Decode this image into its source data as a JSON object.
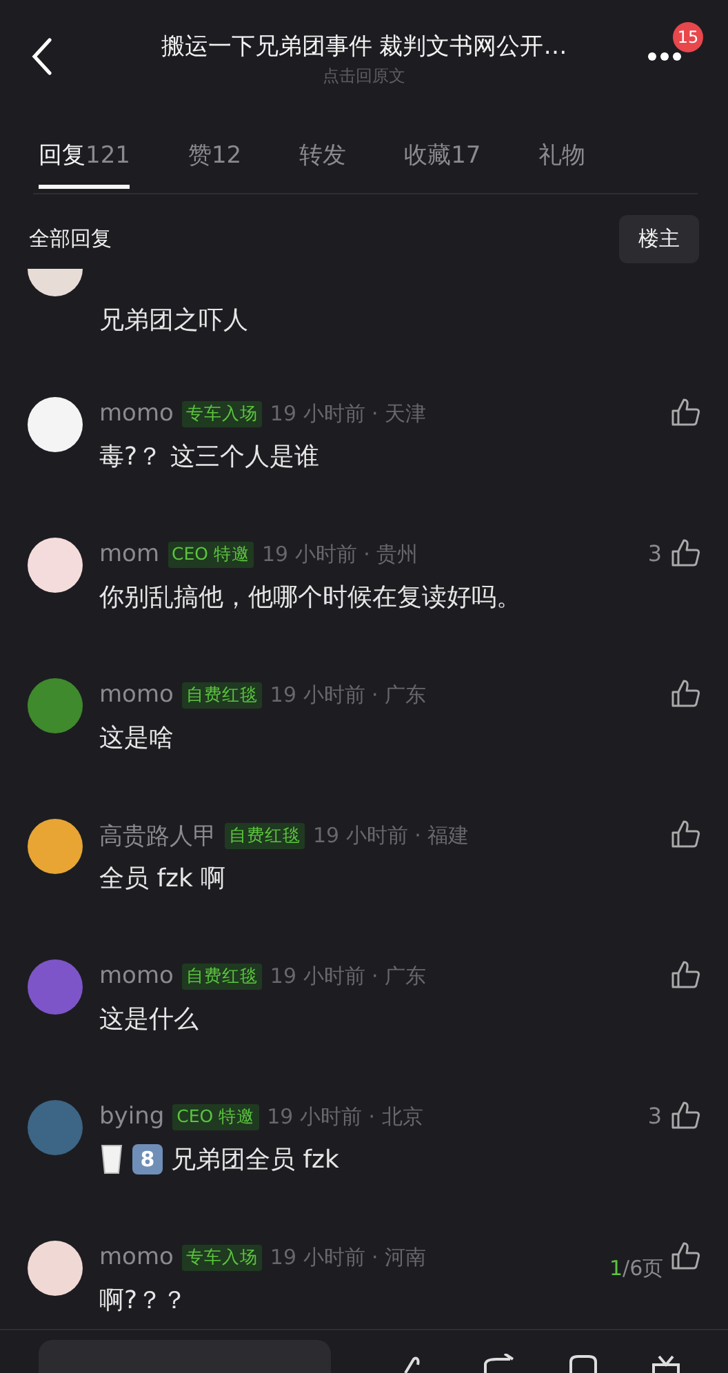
{
  "header": {
    "title": "搬运一下兄弟团事件 裁判文书网公开…",
    "subtitle": "点击回原文",
    "badge": "15"
  },
  "tabs": [
    {
      "label": "回复",
      "count": "121",
      "selected": true
    },
    {
      "label": "赞",
      "count": "12",
      "selected": false
    },
    {
      "label": "转发",
      "selected": false
    },
    {
      "label": "收藏",
      "count": "17",
      "selected": false
    },
    {
      "label": "礼物",
      "selected": false
    }
  ],
  "filter": {
    "label": "全部回复",
    "button": "楼主"
  },
  "comments": [
    {
      "kind": "partial",
      "color": "#e8ddd6",
      "text": "兄弟团之吓人"
    },
    {
      "kind": "full",
      "color": "#f4f4f4",
      "name": "momo",
      "tag": "专车入场",
      "meta": "19 小时前 · 天津",
      "text": "毒?？ 这三个人是谁"
    },
    {
      "kind": "full",
      "color": "#f5dcdc",
      "name": "mom",
      "tag": "CEO 特邀",
      "meta": "19 小时前 · 贵州",
      "text": "你别乱搞他，他哪个时候在复读好吗。",
      "likes": "3"
    },
    {
      "kind": "full",
      "color": "#3f8a2c",
      "name": "momo",
      "tag": "自费红毯",
      "meta": "19 小时前 · 广东",
      "text": "这是啥"
    },
    {
      "kind": "full",
      "color": "#e8a534",
      "name": "高贵路人甲",
      "tag": "自费红毯",
      "meta": "19 小时前 · 福建",
      "text": "全员 fzk 啊"
    },
    {
      "kind": "full",
      "color": "#7e55c8",
      "name": "momo",
      "tag": "自费红毯",
      "meta": "19 小时前 · 广东",
      "text": "这是什么"
    },
    {
      "kind": "full",
      "color": "#3d6585",
      "name": "bying",
      "tag": "CEO 特邀",
      "meta": "19 小时前 · 北京",
      "text": "兄弟团全员 fzk",
      "likes": "3",
      "prefix": [
        {
          "kind": "milk"
        },
        {
          "kind": "keycap",
          "label": "8"
        }
      ]
    },
    {
      "kind": "full",
      "color": "#f0d8d4",
      "name": "momo",
      "tag": "专车入场",
      "meta": "19 小时前 · 河南",
      "text": "啊?？？"
    }
  ],
  "pager": {
    "current": "1",
    "total": "/6页"
  }
}
